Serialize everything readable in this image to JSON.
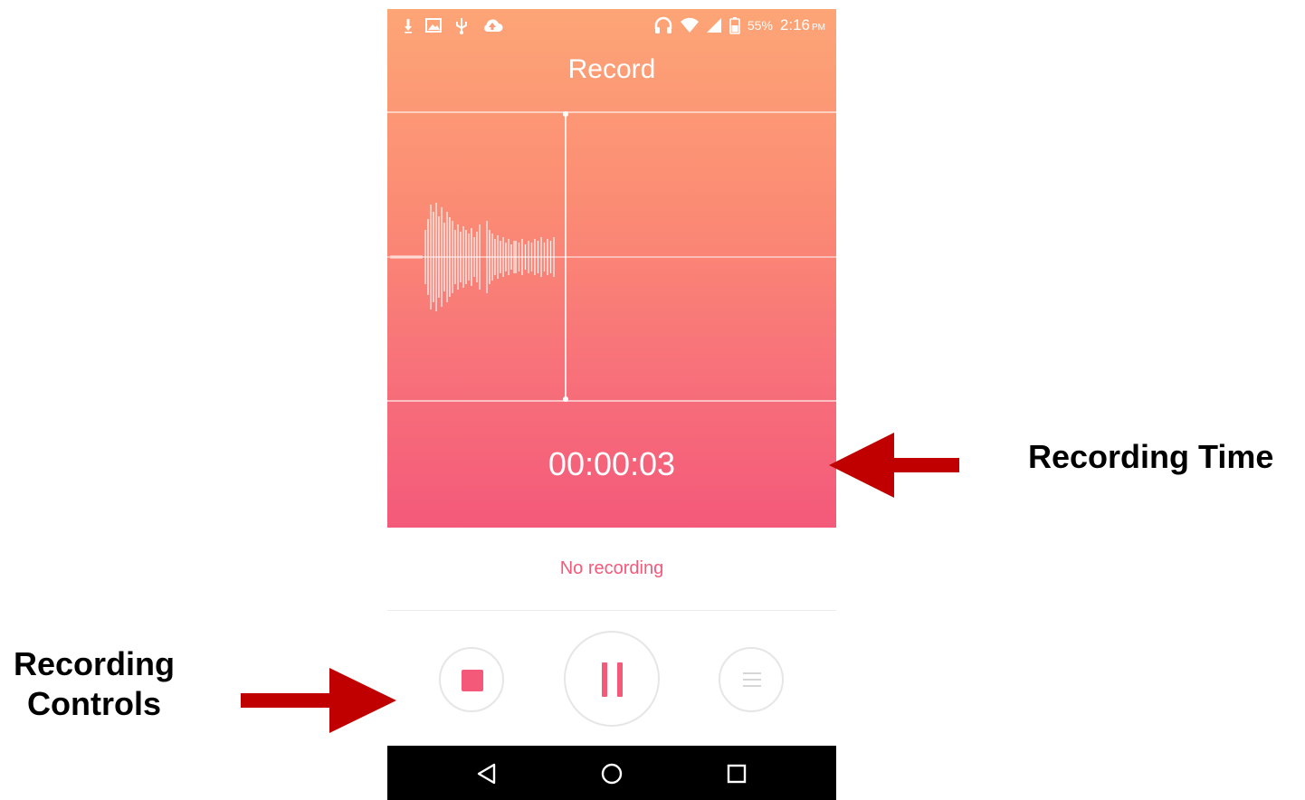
{
  "status_bar": {
    "icons_left": [
      "download-icon",
      "image-icon",
      "usb-icon",
      "cloud-upload-icon"
    ],
    "icons_right": [
      "headphones-icon",
      "wifi-icon",
      "signal-icon",
      "battery-icon"
    ],
    "battery_percent": "55%",
    "time": "2:16",
    "ampm": "PM"
  },
  "app": {
    "title": "Record",
    "recording_time": "00:00:03",
    "status_message": "No recording"
  },
  "controls": {
    "stop": "stop-icon",
    "pause": "pause-icon",
    "list": "list-icon"
  },
  "nav_bar": {
    "back": "back-icon",
    "home": "home-icon",
    "recents": "recents-icon"
  },
  "annotations": {
    "recording_time_label": "Recording Time",
    "recording_controls_line1": "Recording",
    "recording_controls_line2": "Controls"
  },
  "colors": {
    "gradient_top": "#fda576",
    "gradient_bottom": "#f4597a",
    "accent": "#f4597a",
    "arrow": "#c00000"
  }
}
